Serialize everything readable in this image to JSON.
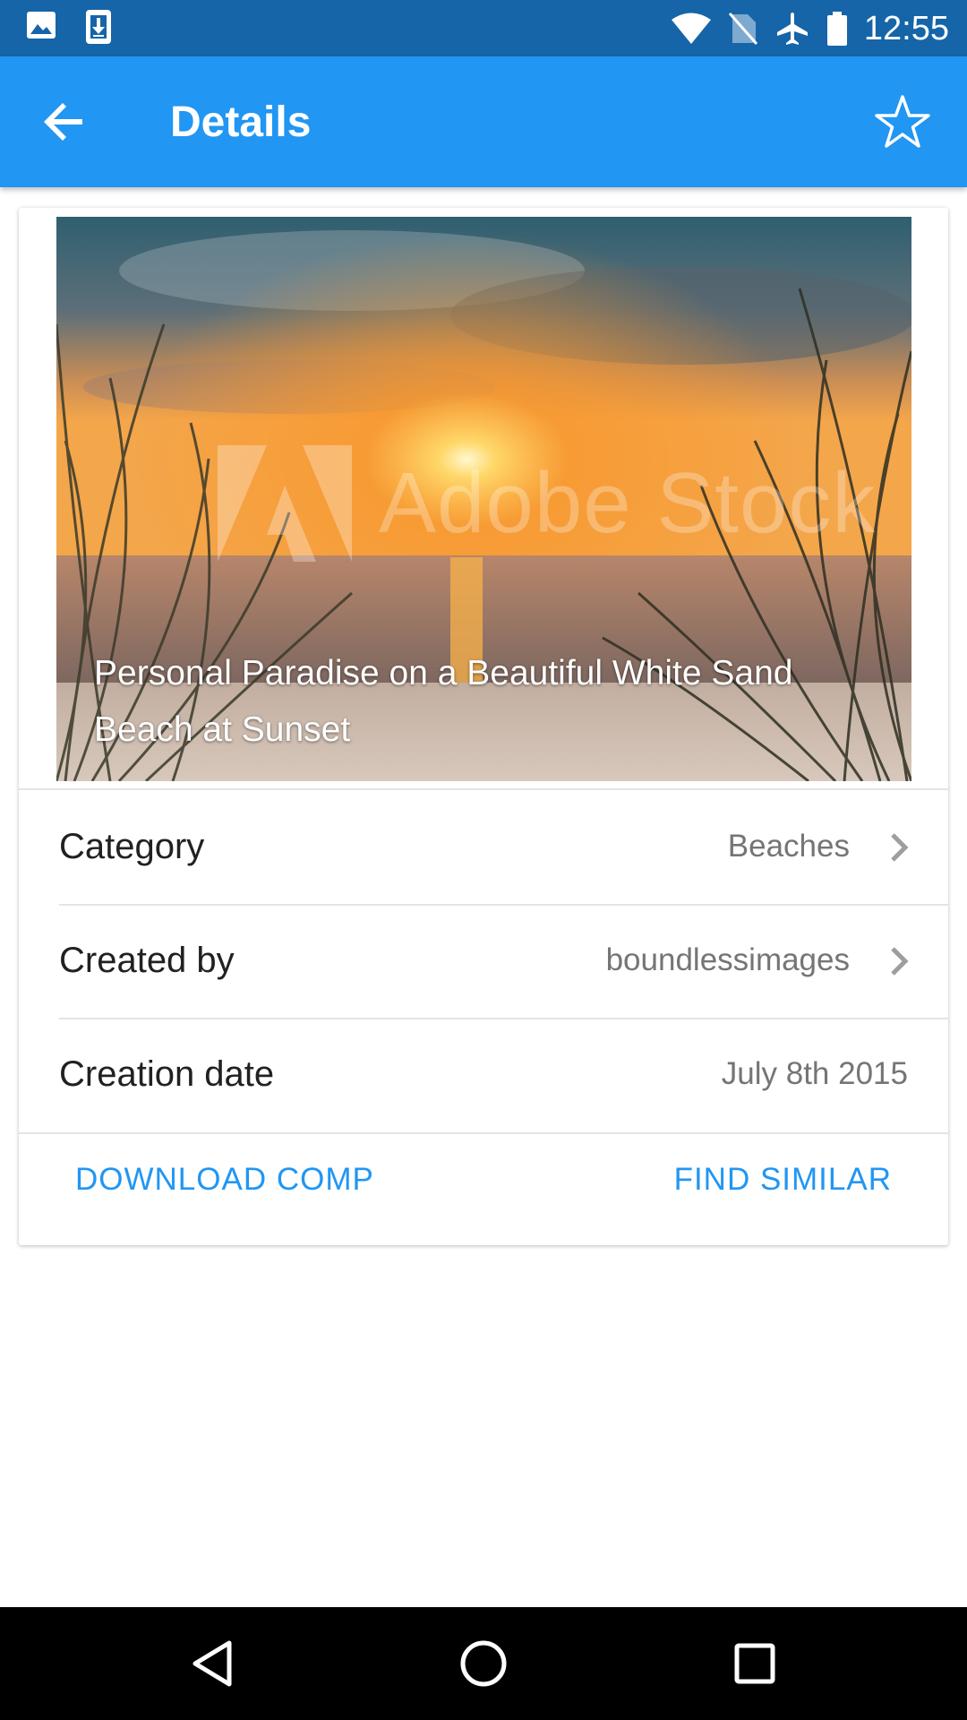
{
  "status_bar": {
    "time": "12:55",
    "left_icons": [
      "image-icon",
      "download-icon"
    ],
    "right_icons": [
      "wifi-icon",
      "no-sim-icon",
      "airplane-icon",
      "battery-icon"
    ]
  },
  "app_bar": {
    "title": "Details",
    "back_icon": "arrow-left-icon",
    "favorite_icon": "star-outline-icon",
    "color": "#2196f3"
  },
  "image": {
    "title": "Personal Paradise on a Beautiful White Sand Beach at Sunset",
    "watermark": "Adobe Stock"
  },
  "details": {
    "category_label": "Category",
    "category_value": "Beaches",
    "created_by_label": "Created by",
    "created_by_value": "boundlessimages",
    "creation_date_label": "Creation date",
    "creation_date_value": "July 8th 2015"
  },
  "actions": {
    "download_label": "DOWNLOAD COMP",
    "find_similar_label": "FIND SIMILAR"
  },
  "nav_bar": {
    "icons": [
      "back-triangle-icon",
      "home-circle-icon",
      "recents-square-icon"
    ]
  }
}
